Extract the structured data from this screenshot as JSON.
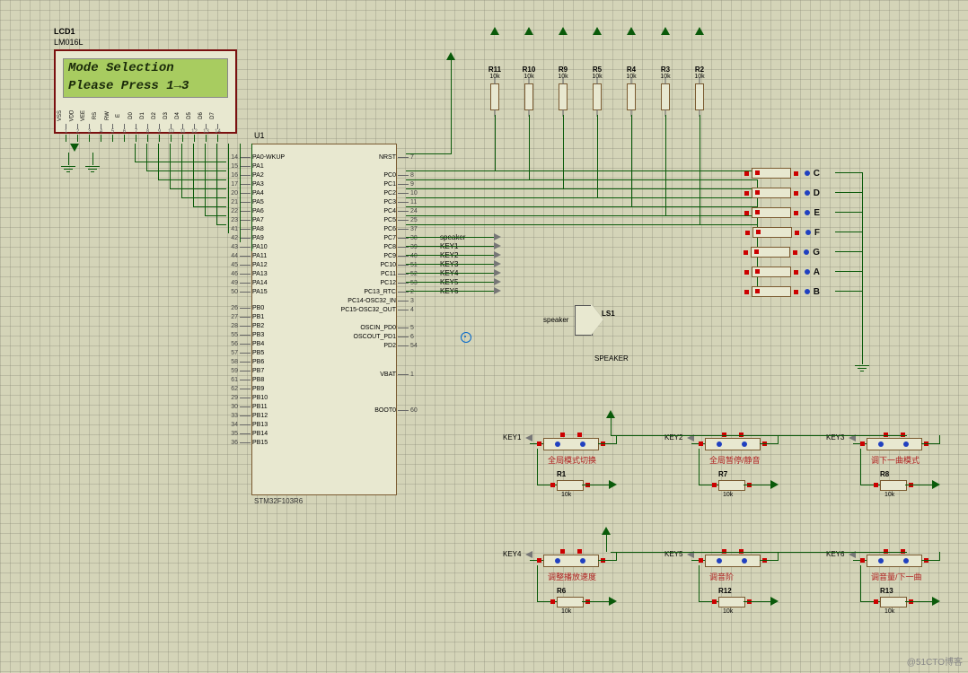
{
  "lcd": {
    "ref": "LCD1",
    "part": "LM016L",
    "line1": "Mode Selection",
    "line2": "Please Press 1→3",
    "pins": [
      "VSS",
      "VDD",
      "VEE",
      "RS",
      "RW",
      "E",
      "D0",
      "D1",
      "D2",
      "D3",
      "D4",
      "D5",
      "D6",
      "D7"
    ],
    "pin_nums": [
      "1",
      "2",
      "3",
      "4",
      "5",
      "6",
      "7",
      "8",
      "9",
      "10",
      "11",
      "12",
      "13",
      "14"
    ]
  },
  "mcu": {
    "ref": "U1",
    "part": "STM32F103R6",
    "left_pins": [
      {
        "num": "14",
        "name": "PA0-WKUP"
      },
      {
        "num": "15",
        "name": "PA1"
      },
      {
        "num": "16",
        "name": "PA2"
      },
      {
        "num": "17",
        "name": "PA3"
      },
      {
        "num": "20",
        "name": "PA4"
      },
      {
        "num": "21",
        "name": "PA5"
      },
      {
        "num": "22",
        "name": "PA6"
      },
      {
        "num": "23",
        "name": "PA7"
      },
      {
        "num": "41",
        "name": "PA8"
      },
      {
        "num": "42",
        "name": "PA9"
      },
      {
        "num": "43",
        "name": "PA10"
      },
      {
        "num": "44",
        "name": "PA11"
      },
      {
        "num": "45",
        "name": "PA12"
      },
      {
        "num": "46",
        "name": "PA13"
      },
      {
        "num": "49",
        "name": "PA14"
      },
      {
        "num": "50",
        "name": "PA15"
      },
      {
        "num": "26",
        "name": "PB0"
      },
      {
        "num": "27",
        "name": "PB1"
      },
      {
        "num": "28",
        "name": "PB2"
      },
      {
        "num": "55",
        "name": "PB3"
      },
      {
        "num": "56",
        "name": "PB4"
      },
      {
        "num": "57",
        "name": "PB5"
      },
      {
        "num": "58",
        "name": "PB6"
      },
      {
        "num": "59",
        "name": "PB7"
      },
      {
        "num": "61",
        "name": "PB8"
      },
      {
        "num": "62",
        "name": "PB9"
      },
      {
        "num": "29",
        "name": "PB10"
      },
      {
        "num": "30",
        "name": "PB11"
      },
      {
        "num": "33",
        "name": "PB12"
      },
      {
        "num": "34",
        "name": "PB13"
      },
      {
        "num": "35",
        "name": "PB14"
      },
      {
        "num": "36",
        "name": "PB15"
      }
    ],
    "right_pins": [
      {
        "num": "7",
        "name": "NRST"
      },
      {
        "num": "8",
        "name": "PC0"
      },
      {
        "num": "9",
        "name": "PC1"
      },
      {
        "num": "10",
        "name": "PC2"
      },
      {
        "num": "11",
        "name": "PC3"
      },
      {
        "num": "24",
        "name": "PC4"
      },
      {
        "num": "25",
        "name": "PC5"
      },
      {
        "num": "37",
        "name": "PC6"
      },
      {
        "num": "38",
        "name": "PC7"
      },
      {
        "num": "39",
        "name": "PC8"
      },
      {
        "num": "40",
        "name": "PC9"
      },
      {
        "num": "51",
        "name": "PC10"
      },
      {
        "num": "52",
        "name": "PC11"
      },
      {
        "num": "53",
        "name": "PC12"
      },
      {
        "num": "2",
        "name": "PC13_RTC"
      },
      {
        "num": "3",
        "name": "PC14-OSC32_IN"
      },
      {
        "num": "4",
        "name": "PC15-OSC32_OUT"
      },
      {
        "num": "5",
        "name": "OSCIN_PD0"
      },
      {
        "num": "6",
        "name": "OSCOUT_PD1"
      },
      {
        "num": "54",
        "name": "PD2"
      },
      {
        "num": "1",
        "name": "VBAT"
      },
      {
        "num": "60",
        "name": "BOOT0"
      }
    ],
    "right_nets": [
      "",
      "",
      "",
      "",
      "",
      "",
      "",
      "",
      "speaker",
      "KEY1",
      "KEY2",
      "KEY3",
      "KEY4",
      "KEY5",
      "KEY6",
      "",
      "",
      "",
      "",
      "",
      "",
      ""
    ]
  },
  "resistors_top": [
    {
      "name": "R11",
      "val": "10k"
    },
    {
      "name": "R10",
      "val": "10k"
    },
    {
      "name": "R9",
      "val": "10k"
    },
    {
      "name": "R5",
      "val": "10k"
    },
    {
      "name": "R4",
      "val": "10k"
    },
    {
      "name": "R3",
      "val": "10k"
    },
    {
      "name": "R2",
      "val": "10k"
    }
  ],
  "leds": [
    "C",
    "D",
    "E",
    "F",
    "G",
    "A",
    "B"
  ],
  "speaker": {
    "ref": "LS1",
    "part": "SPEAKER",
    "net": "speaker"
  },
  "keys": [
    {
      "net": "KEY1",
      "cap": "全局模式切换",
      "res": "R1",
      "val": "10k"
    },
    {
      "net": "KEY2",
      "cap": "全局暂停/静音",
      "res": "R7",
      "val": "10k"
    },
    {
      "net": "KEY3",
      "cap": "调下一曲模式",
      "res": "R8",
      "val": "10k"
    },
    {
      "net": "KEY4",
      "cap": "调整播放速度",
      "res": "R6",
      "val": "10k"
    },
    {
      "net": "KEY5",
      "cap": "调音阶",
      "res": "R12",
      "val": "10k"
    },
    {
      "net": "KEY6",
      "cap": "调音量/下一曲",
      "res": "R13",
      "val": "10k"
    }
  ],
  "watermark": "@51CTO博客"
}
